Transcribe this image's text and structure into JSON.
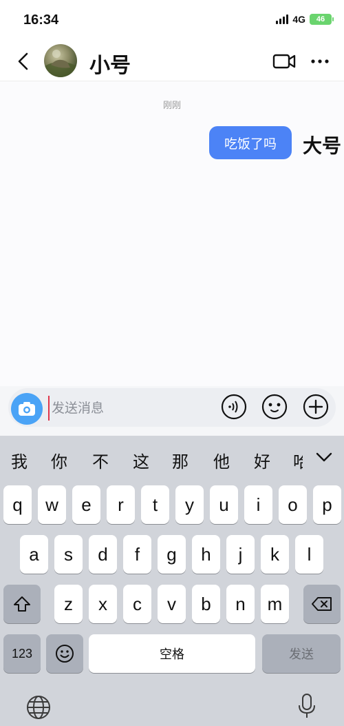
{
  "status": {
    "time": "16:34",
    "network": "4G",
    "battery": "46"
  },
  "header": {
    "title": "小号"
  },
  "chat": {
    "timestamp": "刚刚",
    "message": "吃饭了吗",
    "sender_label": "大号"
  },
  "input": {
    "placeholder": "发送消息"
  },
  "keyboard": {
    "candidates": [
      "我",
      "你",
      "不",
      "这",
      "那",
      "他",
      "好",
      "哈"
    ],
    "row1": [
      "q",
      "w",
      "e",
      "r",
      "t",
      "y",
      "u",
      "i",
      "o",
      "p"
    ],
    "row2": [
      "a",
      "s",
      "d",
      "f",
      "g",
      "h",
      "j",
      "k",
      "l"
    ],
    "row3": [
      "z",
      "x",
      "c",
      "v",
      "b",
      "n",
      "m"
    ],
    "numbers_label": "123",
    "space_label": "空格",
    "send_label": "发送"
  }
}
